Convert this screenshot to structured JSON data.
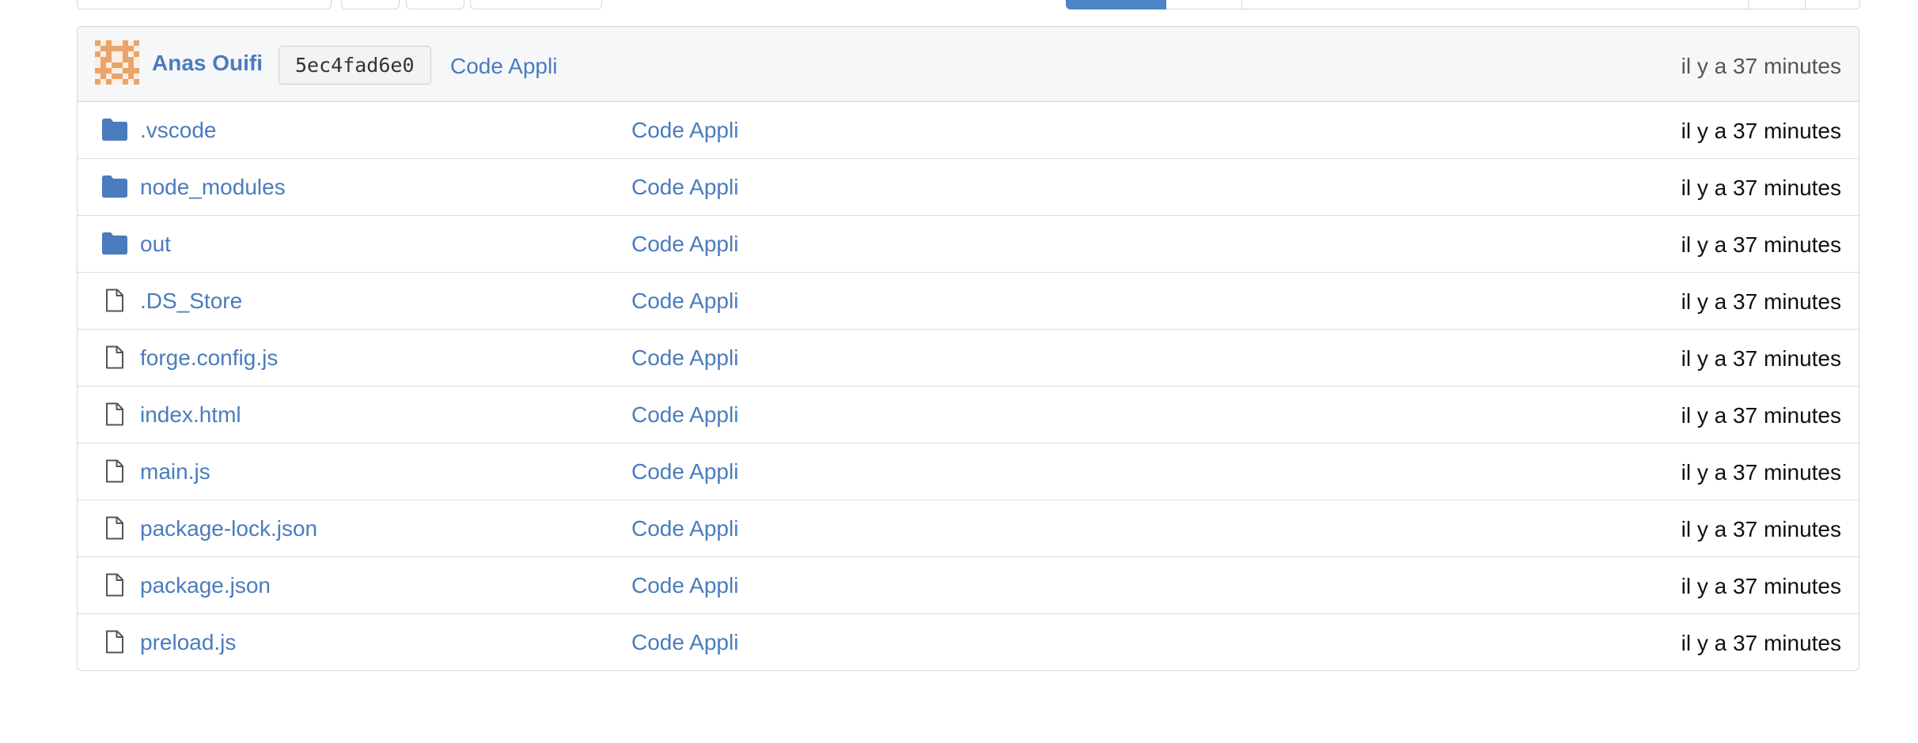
{
  "colors": {
    "link": "#4a7cbd",
    "folder": "#4a7cbd",
    "file": "#555555",
    "avatar": "#e8a56b",
    "primary_tab": "#4c85c7"
  },
  "last_commit": {
    "author": "Anas Ouifi",
    "sha": "5ec4fad6e0",
    "message": "Code Appli",
    "time": "il y a 37 minutes",
    "avatar_icon": "identicon-avatar"
  },
  "files": [
    {
      "name": ".vscode",
      "type": "folder",
      "icon": "folder-icon",
      "message": "Code Appli",
      "time": "il y a 37 minutes"
    },
    {
      "name": "node_modules",
      "type": "folder",
      "icon": "folder-icon",
      "message": "Code Appli",
      "time": "il y a 37 minutes"
    },
    {
      "name": "out",
      "type": "folder",
      "icon": "folder-icon",
      "message": "Code Appli",
      "time": "il y a 37 minutes"
    },
    {
      "name": ".DS_Store",
      "type": "file",
      "icon": "file-icon",
      "message": "Code Appli",
      "time": "il y a 37 minutes"
    },
    {
      "name": "forge.config.js",
      "type": "file",
      "icon": "file-icon",
      "message": "Code Appli",
      "time": "il y a 37 minutes"
    },
    {
      "name": "index.html",
      "type": "file",
      "icon": "file-icon",
      "message": "Code Appli",
      "time": "il y a 37 minutes"
    },
    {
      "name": "main.js",
      "type": "file",
      "icon": "file-icon",
      "message": "Code Appli",
      "time": "il y a 37 minutes"
    },
    {
      "name": "package-lock.json",
      "type": "file",
      "icon": "file-icon",
      "message": "Code Appli",
      "time": "il y a 37 minutes"
    },
    {
      "name": "package.json",
      "type": "file",
      "icon": "file-icon",
      "message": "Code Appli",
      "time": "il y a 37 minutes"
    },
    {
      "name": "preload.js",
      "type": "file",
      "icon": "file-icon",
      "message": "Code Appli",
      "time": "il y a 37 minutes"
    }
  ]
}
